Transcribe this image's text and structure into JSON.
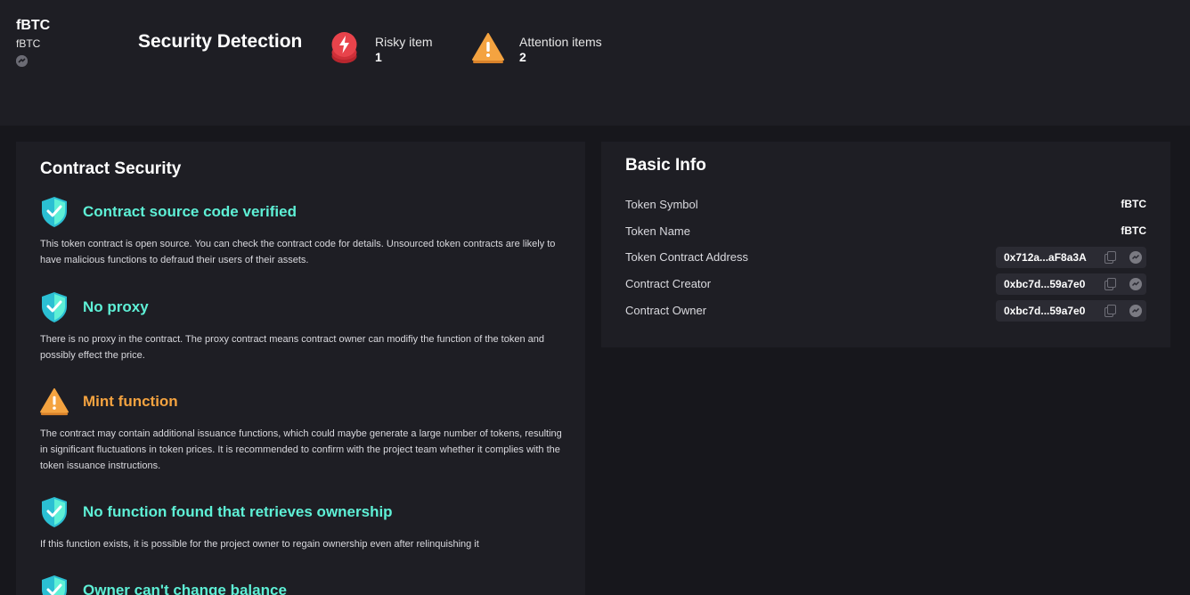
{
  "header": {
    "token_name": "fBTC",
    "token_symbol": "fBTC",
    "chain_icon": "chain-explorer-icon",
    "title": "Security Detection",
    "risky": {
      "label": "Risky item",
      "count": "1",
      "icon": "lightning-shield-icon",
      "color": "#e8434b"
    },
    "attention": {
      "label": "Attention items",
      "count": "2",
      "icon": "warning-triangle-icon",
      "color": "#f4a340"
    }
  },
  "contract_security": {
    "title": "Contract Security",
    "items": [
      {
        "status": "ok",
        "icon": "shield-check-icon",
        "title": "Contract source code verified",
        "description": "This token contract is open source. You can check the contract code for details. Unsourced token contracts are likely to have malicious functions to defraud their users of their assets."
      },
      {
        "status": "ok",
        "icon": "shield-check-icon",
        "title": "No proxy",
        "description": "There is no proxy in the contract. The proxy contract means contract owner can modifiy the function of the token and possibly effect the price."
      },
      {
        "status": "warn",
        "icon": "warning-triangle-icon",
        "title": "Mint function",
        "description": "The contract may contain additional issuance functions, which could maybe generate a large number of tokens, resulting in significant fluctuations in token prices. It is recommended to confirm with the project team whether it complies with the token issuance instructions."
      },
      {
        "status": "ok",
        "icon": "shield-check-icon",
        "title": "No function found that retrieves ownership",
        "description": "If this function exists, it is possible for the project owner to regain ownership even after relinquishing it"
      },
      {
        "status": "ok",
        "icon": "shield-check-icon",
        "title": "Owner can't change balance",
        "description": ""
      }
    ]
  },
  "basic_info": {
    "title": "Basic Info",
    "rows": [
      {
        "label": "Token Symbol",
        "value": "fBTC"
      },
      {
        "label": "Token Name",
        "value": "fBTC"
      },
      {
        "label": "Token Contract Address",
        "value": "0x712a...aF8a3A"
      },
      {
        "label": "Contract Creator",
        "value": "0xbc7d...59a7e0"
      },
      {
        "label": "Contract Owner",
        "value": "0xbc7d...59a7e0"
      }
    ]
  },
  "colors": {
    "ok": "#5ef0d6",
    "warn": "#f4a340",
    "risk": "#e8434b",
    "panel": "#1e1e24",
    "background": "#17171c"
  }
}
